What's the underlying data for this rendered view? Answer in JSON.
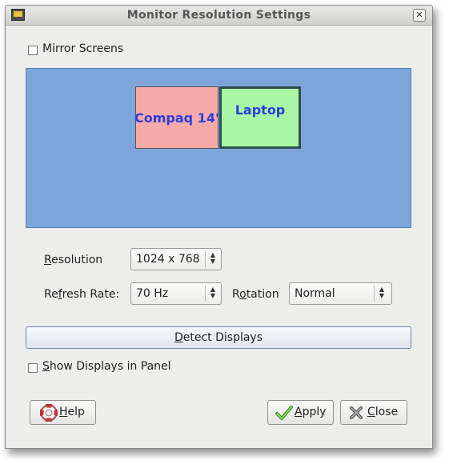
{
  "window": {
    "title": "Monitor Resolution Settings",
    "icon": "monitor-icon",
    "close_icon": "close-icon"
  },
  "mirror": {
    "label": "Mirror Screens",
    "checked": false
  },
  "displays": [
    {
      "name": "Compaq 14\"",
      "color": "#f6a9a9"
    },
    {
      "name": "Laptop",
      "color": "#a9f6a4",
      "selected": true
    }
  ],
  "display_area_color": "#7ea5d9",
  "resolution": {
    "label_underlined": "R",
    "label_rest": "esolution",
    "value": "1024 x 768"
  },
  "refresh": {
    "label_pre": "Re",
    "label_underlined": "f",
    "label_rest": "resh Rate:",
    "value": "70 Hz"
  },
  "rotation": {
    "label_pre": "R",
    "label_underlined": "o",
    "label_rest": "tation",
    "value": "Normal"
  },
  "detect": {
    "label_underlined": "D",
    "label_rest": "etect Displays"
  },
  "show_in_panel": {
    "label_underlined": "S",
    "label_rest": "how Displays in Panel",
    "checked": false
  },
  "buttons": {
    "help": {
      "label_underlined": "H",
      "label_rest": "elp",
      "icon": "lifebuoy-icon"
    },
    "apply": {
      "label_underlined": "A",
      "label_rest": "pply",
      "icon": "checkmark-icon"
    },
    "close": {
      "label_underlined": "C",
      "label_rest": "lose",
      "icon": "close-x-icon"
    }
  }
}
